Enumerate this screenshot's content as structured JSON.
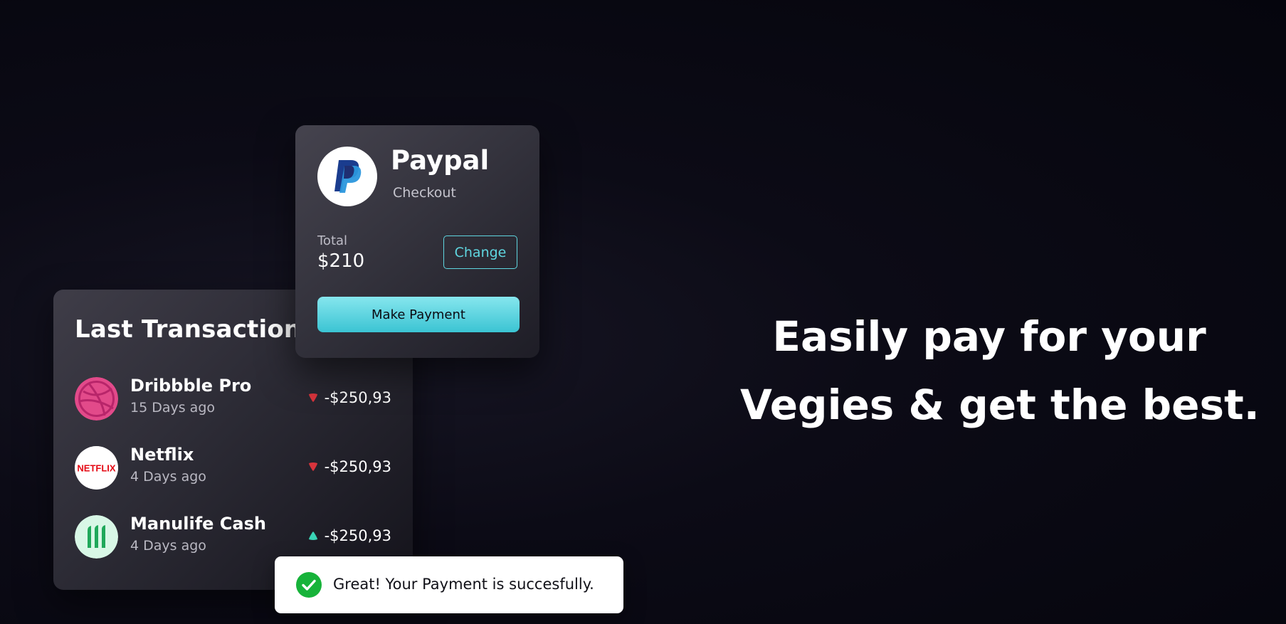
{
  "transactions_card": {
    "title": "Last Transaction",
    "items": [
      {
        "name": "Dribbble Pro",
        "time": "15 Days ago",
        "amount": "-$250,93",
        "trend": "down",
        "logo_icon": "dribbble-icon"
      },
      {
        "name": "Netflix",
        "time": "4 Days ago",
        "amount": "-$250,93",
        "trend": "down",
        "logo_icon": "netflix-icon",
        "logo_text": "NETFLIX"
      },
      {
        "name": "Manulife Cash",
        "time": "4 Days ago",
        "amount": "-$250,93",
        "trend": "up",
        "logo_icon": "manulife-icon"
      }
    ]
  },
  "paypal_card": {
    "title": "Paypal",
    "subtitle": "Checkout",
    "total_label": "Total",
    "total_value": "$210",
    "change_label": "Change",
    "pay_label": "Make Payment",
    "logo_icon": "paypal-icon"
  },
  "toast": {
    "message": "Great! Your Payment is succesfully.",
    "icon": "check-circle-icon"
  },
  "headline": {
    "line1": "Easily pay for your",
    "line2": "Vegies & get the best."
  },
  "colors": {
    "accent": "#5fd6e0",
    "negative": "#d8343c",
    "positive": "#3ad4b6",
    "success": "#17b33a",
    "dribbble": "#e24a8a",
    "netflix": "#e50914",
    "manulife": "#1fa85a"
  }
}
